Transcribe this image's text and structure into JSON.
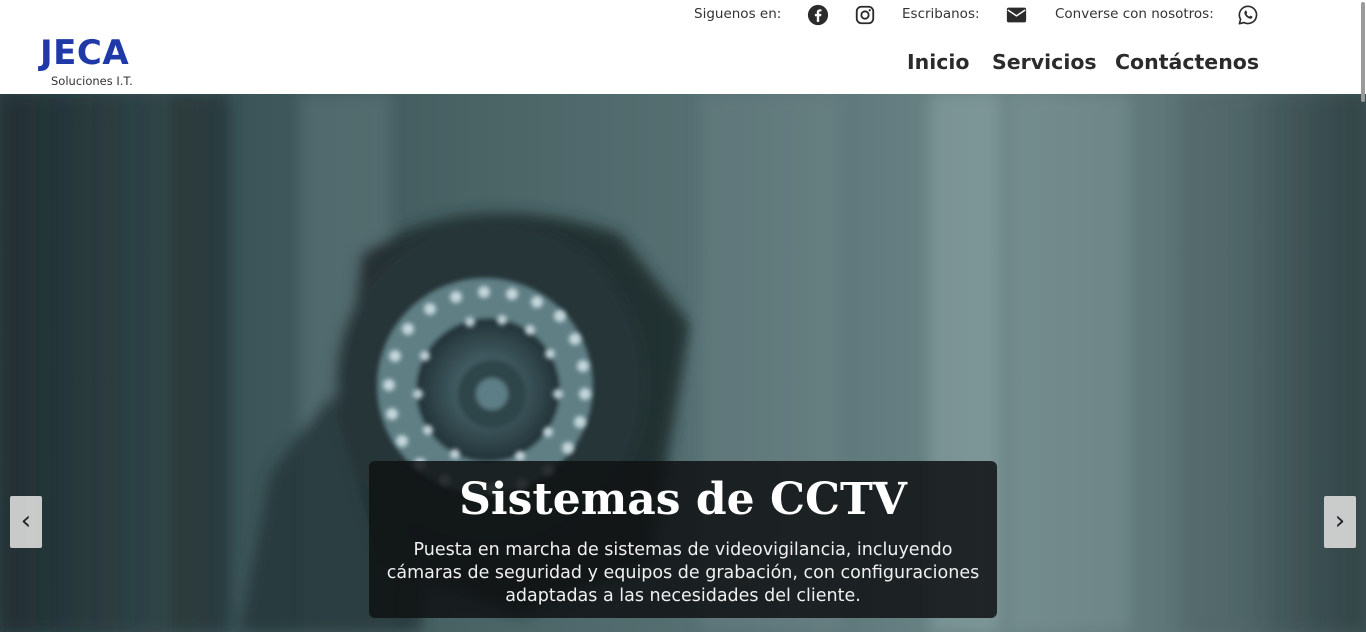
{
  "brand": {
    "name": "JECA",
    "tagline": "Soluciones I.T.",
    "color": "#1f3aa8"
  },
  "topbar": {
    "follow_label": "Siguenos en:",
    "write_label": "Escribanos:",
    "chat_label": "Converse con nosotros:",
    "icons": [
      "facebook-icon",
      "instagram-icon",
      "email-icon",
      "whatsapp-icon"
    ]
  },
  "nav": {
    "items": [
      {
        "label": "Inicio"
      },
      {
        "label": "Servicios"
      },
      {
        "label": "Contáctenos"
      }
    ]
  },
  "hero": {
    "title": "Sistemas de CCTV",
    "description": "Puesta en marcha de sistemas de videovigilancia, incluyendo cámaras de seguridad y equipos de grabación, con configuraciones adaptadas a las necesidades del cliente.",
    "prev_label": "‹",
    "next_label": "›"
  }
}
